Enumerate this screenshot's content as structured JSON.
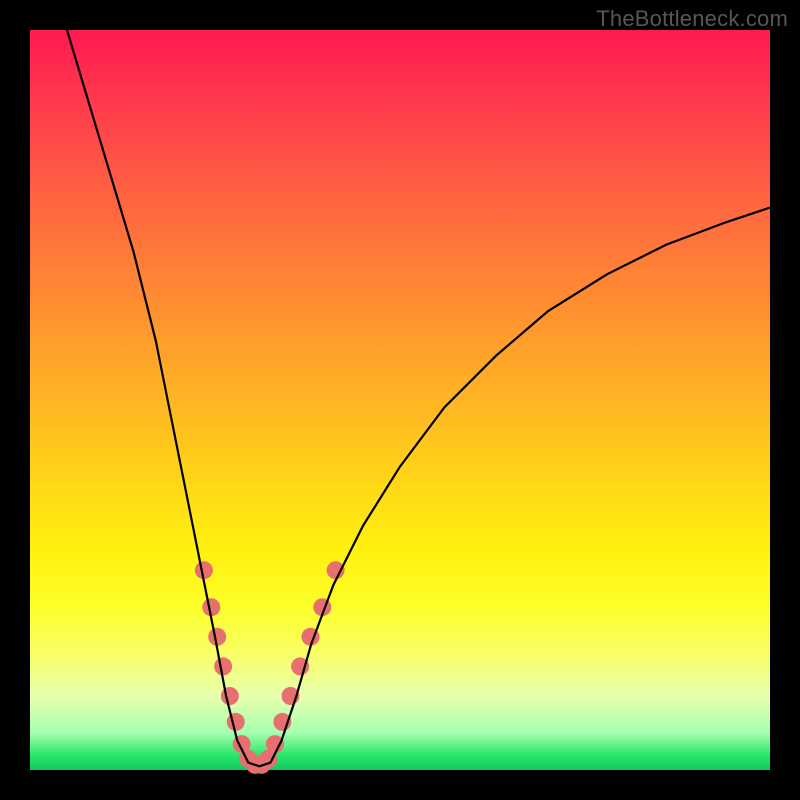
{
  "watermark": "TheBottleneck.com",
  "chart_data": {
    "type": "line",
    "title": "",
    "xlabel": "",
    "ylabel": "",
    "xlim": [
      0,
      100
    ],
    "ylim": [
      0,
      100
    ],
    "curve": {
      "name": "bottleneck-curve",
      "color": "#000000",
      "points": [
        {
          "x": 5,
          "y": 100
        },
        {
          "x": 8,
          "y": 90
        },
        {
          "x": 11,
          "y": 80
        },
        {
          "x": 14,
          "y": 70
        },
        {
          "x": 17,
          "y": 58
        },
        {
          "x": 19,
          "y": 48
        },
        {
          "x": 21,
          "y": 38
        },
        {
          "x": 23,
          "y": 28
        },
        {
          "x": 25,
          "y": 18
        },
        {
          "x": 26.5,
          "y": 10
        },
        {
          "x": 28,
          "y": 4
        },
        {
          "x": 29.5,
          "y": 1
        },
        {
          "x": 31,
          "y": 0.5
        },
        {
          "x": 32.5,
          "y": 1
        },
        {
          "x": 34,
          "y": 4
        },
        {
          "x": 36,
          "y": 10
        },
        {
          "x": 38,
          "y": 17
        },
        {
          "x": 41,
          "y": 25
        },
        {
          "x": 45,
          "y": 33
        },
        {
          "x": 50,
          "y": 41
        },
        {
          "x": 56,
          "y": 49
        },
        {
          "x": 63,
          "y": 56
        },
        {
          "x": 70,
          "y": 62
        },
        {
          "x": 78,
          "y": 67
        },
        {
          "x": 86,
          "y": 71
        },
        {
          "x": 94,
          "y": 74
        },
        {
          "x": 100,
          "y": 76
        }
      ]
    },
    "highlight_dots": {
      "color": "#e86f6f",
      "radius": 9,
      "points": [
        {
          "x": 23.5,
          "y": 27
        },
        {
          "x": 24.5,
          "y": 22
        },
        {
          "x": 25.3,
          "y": 18
        },
        {
          "x": 26.1,
          "y": 14
        },
        {
          "x": 27.0,
          "y": 10
        },
        {
          "x": 27.8,
          "y": 6.5
        },
        {
          "x": 28.6,
          "y": 3.5
        },
        {
          "x": 29.5,
          "y": 1.5
        },
        {
          "x": 30.4,
          "y": 0.7
        },
        {
          "x": 31.3,
          "y": 0.7
        },
        {
          "x": 32.2,
          "y": 1.5
        },
        {
          "x": 33.1,
          "y": 3.5
        },
        {
          "x": 34.1,
          "y": 6.5
        },
        {
          "x": 35.2,
          "y": 10
        },
        {
          "x": 36.5,
          "y": 14
        },
        {
          "x": 37.9,
          "y": 18
        },
        {
          "x": 39.5,
          "y": 22
        },
        {
          "x": 41.3,
          "y": 27
        }
      ]
    }
  }
}
